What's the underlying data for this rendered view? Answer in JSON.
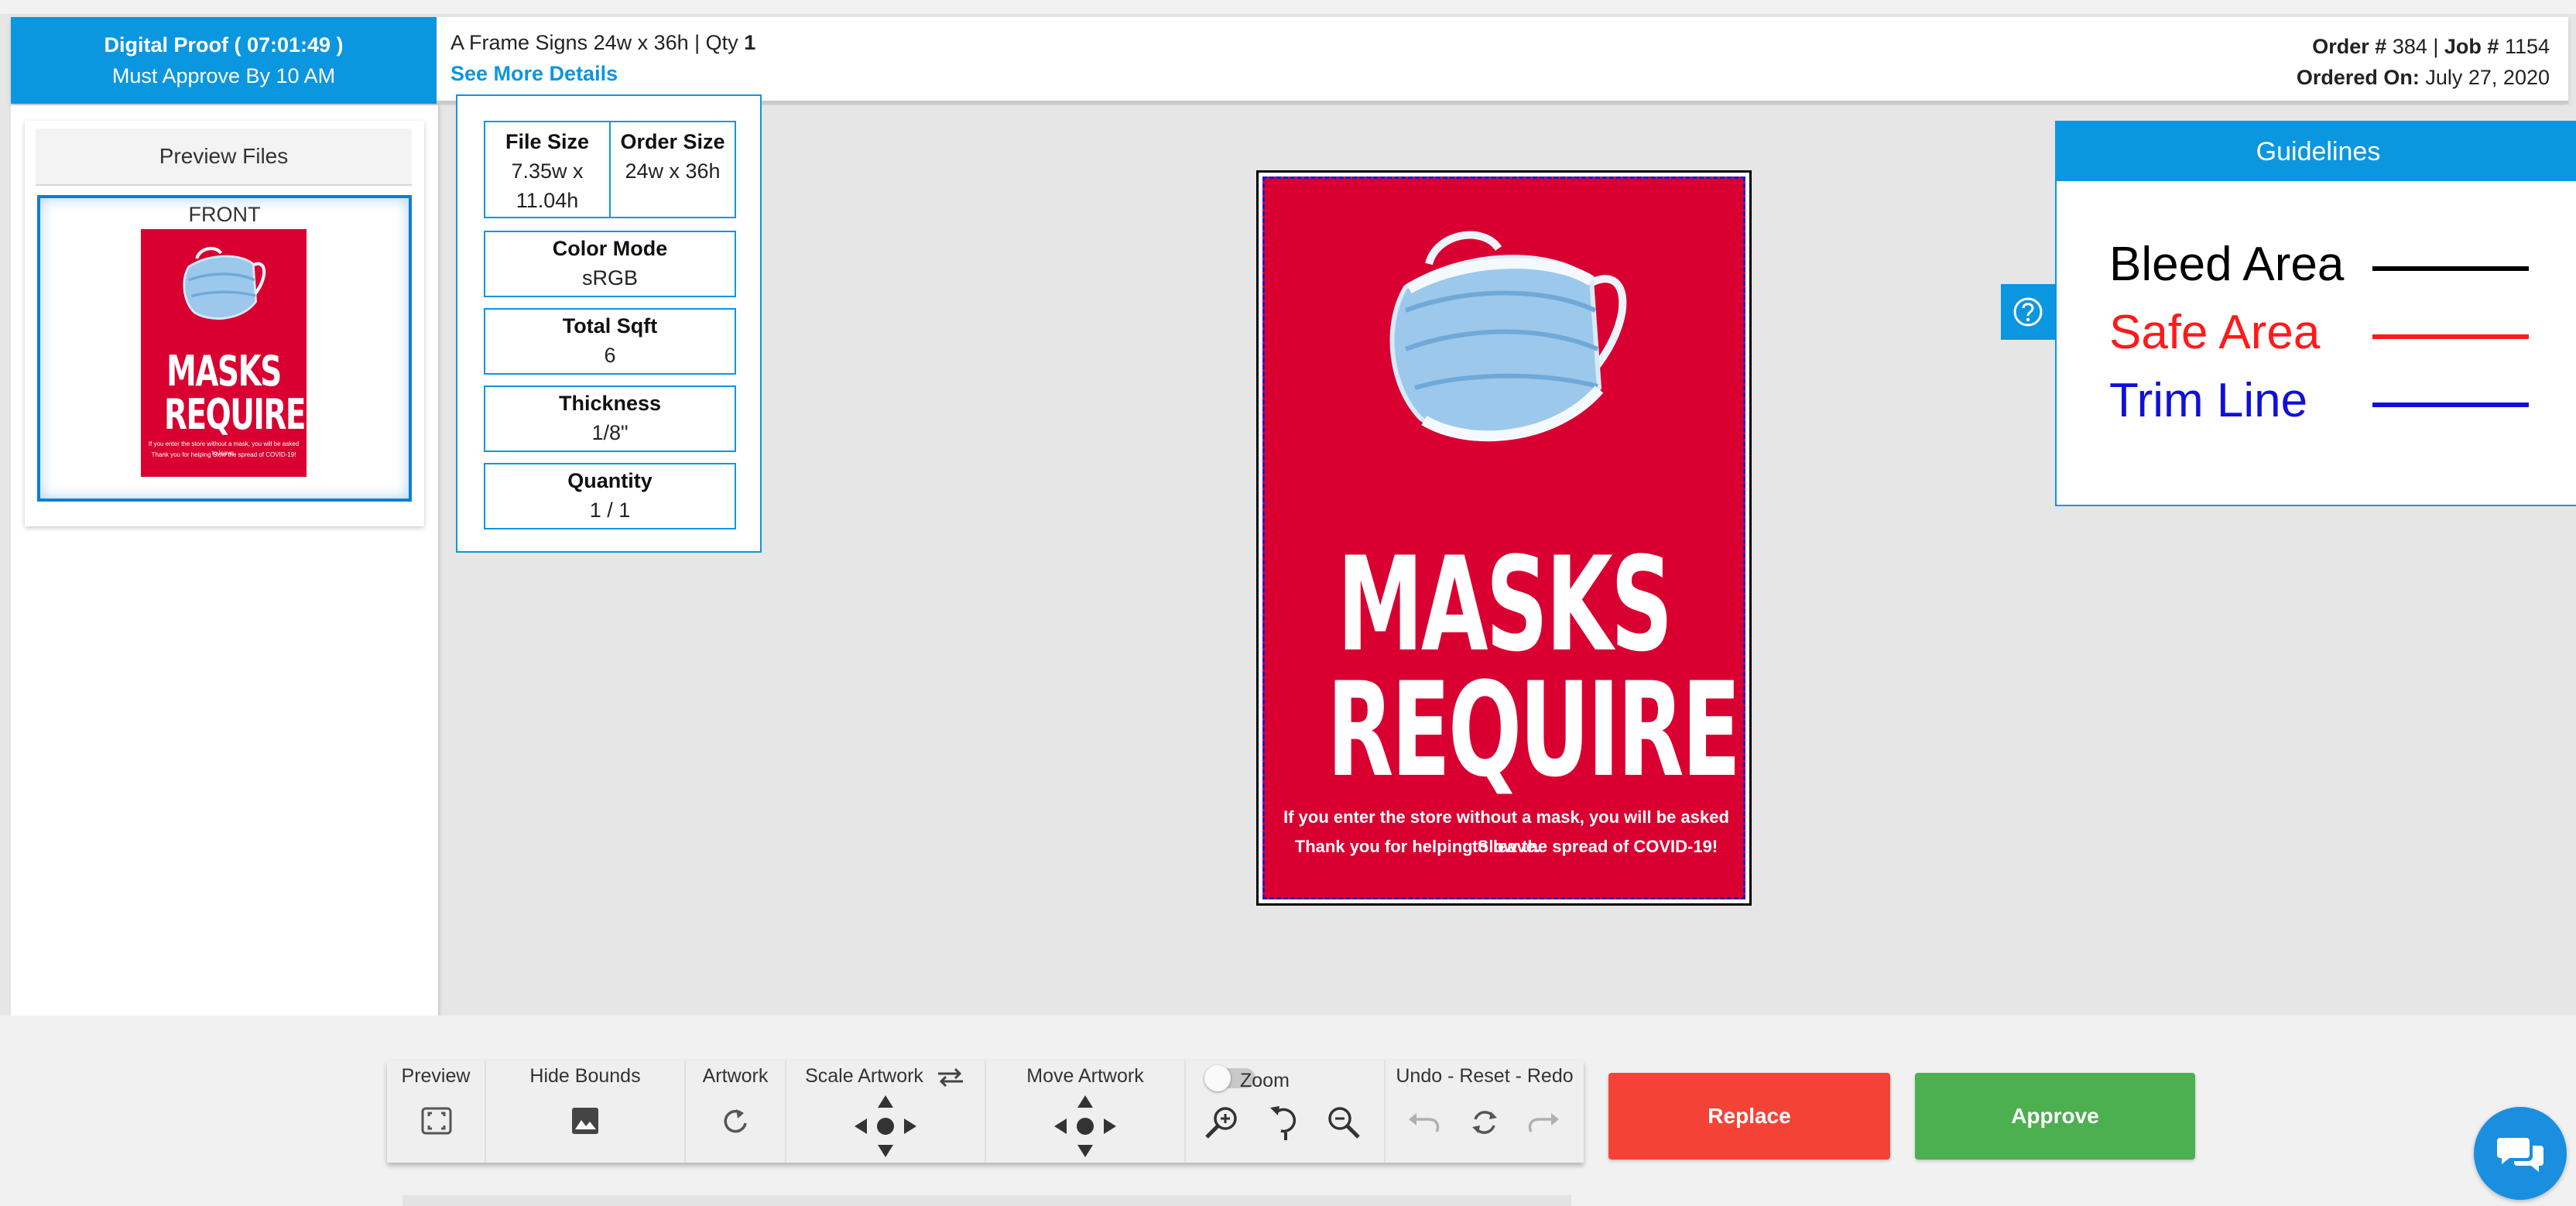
{
  "header": {
    "proof_title": "Digital Proof ( 07:01:49 )",
    "approve_deadline": "Must Approve By 10 AM",
    "product_text": "A Frame Signs 24w x 36h | Qty ",
    "product_qty": "1",
    "see_more": "See More Details",
    "order_label": "Order # ",
    "order_number": "384",
    "job_sep": " | ",
    "job_label": "Job # ",
    "job_number": "1154",
    "ordered_on_label": "Ordered On: ",
    "ordered_on_date": "July 27, 2020"
  },
  "preview_panel": {
    "button_label": "Preview Files",
    "front_label": "FRONT"
  },
  "specs": {
    "file_size_label": "File Size",
    "file_size_value_1": "7.35w x",
    "file_size_value_2": "11.04h",
    "order_size_label": "Order Size",
    "order_size_value": "24w x 36h",
    "color_mode_label": "Color Mode",
    "color_mode_value": "sRGB",
    "total_sqft_label": "Total Sqft",
    "total_sqft_value": "6",
    "thickness_label": "Thickness",
    "thickness_value": "1/8\"",
    "quantity_label": "Quantity",
    "quantity_value": "1 / 1"
  },
  "artwork": {
    "title_line1": "MASKS",
    "title_line2": "REQUIRED",
    "sub_line1": "If you enter the store without a mask, you will be asked to leave.",
    "sub_line2": "Thank you for helping Slow the spread of COVID-19!",
    "background_color": "#d90031"
  },
  "guidelines": {
    "title": "Guidelines",
    "items": [
      {
        "label": "Bleed Area",
        "color": "#000000"
      },
      {
        "label": "Safe Area",
        "color": "#ff1a1a"
      },
      {
        "label": "Trim Line",
        "color": "#1010d8"
      }
    ]
  },
  "toolbar": {
    "preview_label": "Preview",
    "hide_bounds_label": "Hide Bounds",
    "artwork_label": "Artwork",
    "scale_label": "Scale Artwork",
    "move_label": "Move Artwork",
    "zoom_label": "Zoom",
    "undo_reset_redo_label": "Undo - Reset - Redo",
    "zoom_toggle_on": false
  },
  "actions": {
    "replace_label": "Replace",
    "approve_label": "Approve"
  },
  "colors": {
    "accent": "#0b96e0",
    "replace": "#f44336",
    "approve": "#4caf50"
  }
}
